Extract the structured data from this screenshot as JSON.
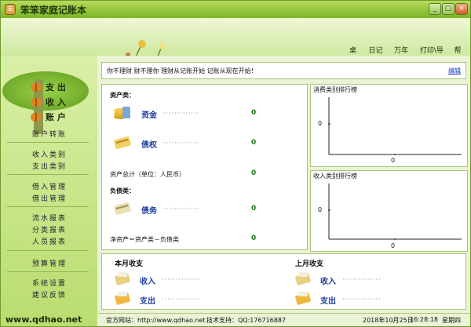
{
  "window": {
    "title": "笨笨家庭记账本",
    "min": "_",
    "max": "□",
    "close": "×"
  },
  "toolbar": [
    "桌面",
    "日记本",
    "万年历",
    "打印\\导出",
    "帮助"
  ],
  "sidebar": {
    "big": [
      "支 出",
      "收 入",
      "账 户"
    ],
    "groups": [
      [
        "账户转账"
      ],
      [
        "收入类别",
        "支出类别"
      ],
      [
        "借入管理",
        "借出管理"
      ],
      [
        "流水报表",
        "分类报表",
        "人员报表"
      ],
      [
        "预算管理"
      ],
      [
        "系统设置",
        "建议反馈"
      ]
    ],
    "site": "www.qdhao.net"
  },
  "notice": {
    "text": "你不理财   财不理你   理财从记账开始   记账从现在开始！",
    "edit": "编辑"
  },
  "assets": {
    "assets_title": "资产类：",
    "cash_label": "资金",
    "cash_value": "0",
    "credit_label": "债权",
    "credit_value": "0",
    "total_label": "资产总计（单位：人民币）",
    "total_value": "0",
    "liab_title": "负债类：",
    "debt_label": "债务",
    "debt_value": "0",
    "net_label": "净资产＝资产类－负债类",
    "net_value": "0",
    "dots": "·············"
  },
  "charts": {
    "expense": {
      "title": "消费类别排行榜",
      "y_tick": "0",
      "x_tick": "0"
    },
    "income": {
      "title": "收入类别排行榜",
      "y_tick": "0",
      "x_tick": "0"
    }
  },
  "monthly": {
    "this_month": "本月收支",
    "last_month": "上月收支",
    "income": "收入",
    "expense": "支出",
    "dots": "··············"
  },
  "status": {
    "site": "官方网站：http://www.qdhao.net",
    "support": "技术支持：QQ:176716887",
    "date": "2018年10月25日",
    "time": "16:28:18",
    "weekday": "星期四"
  }
}
